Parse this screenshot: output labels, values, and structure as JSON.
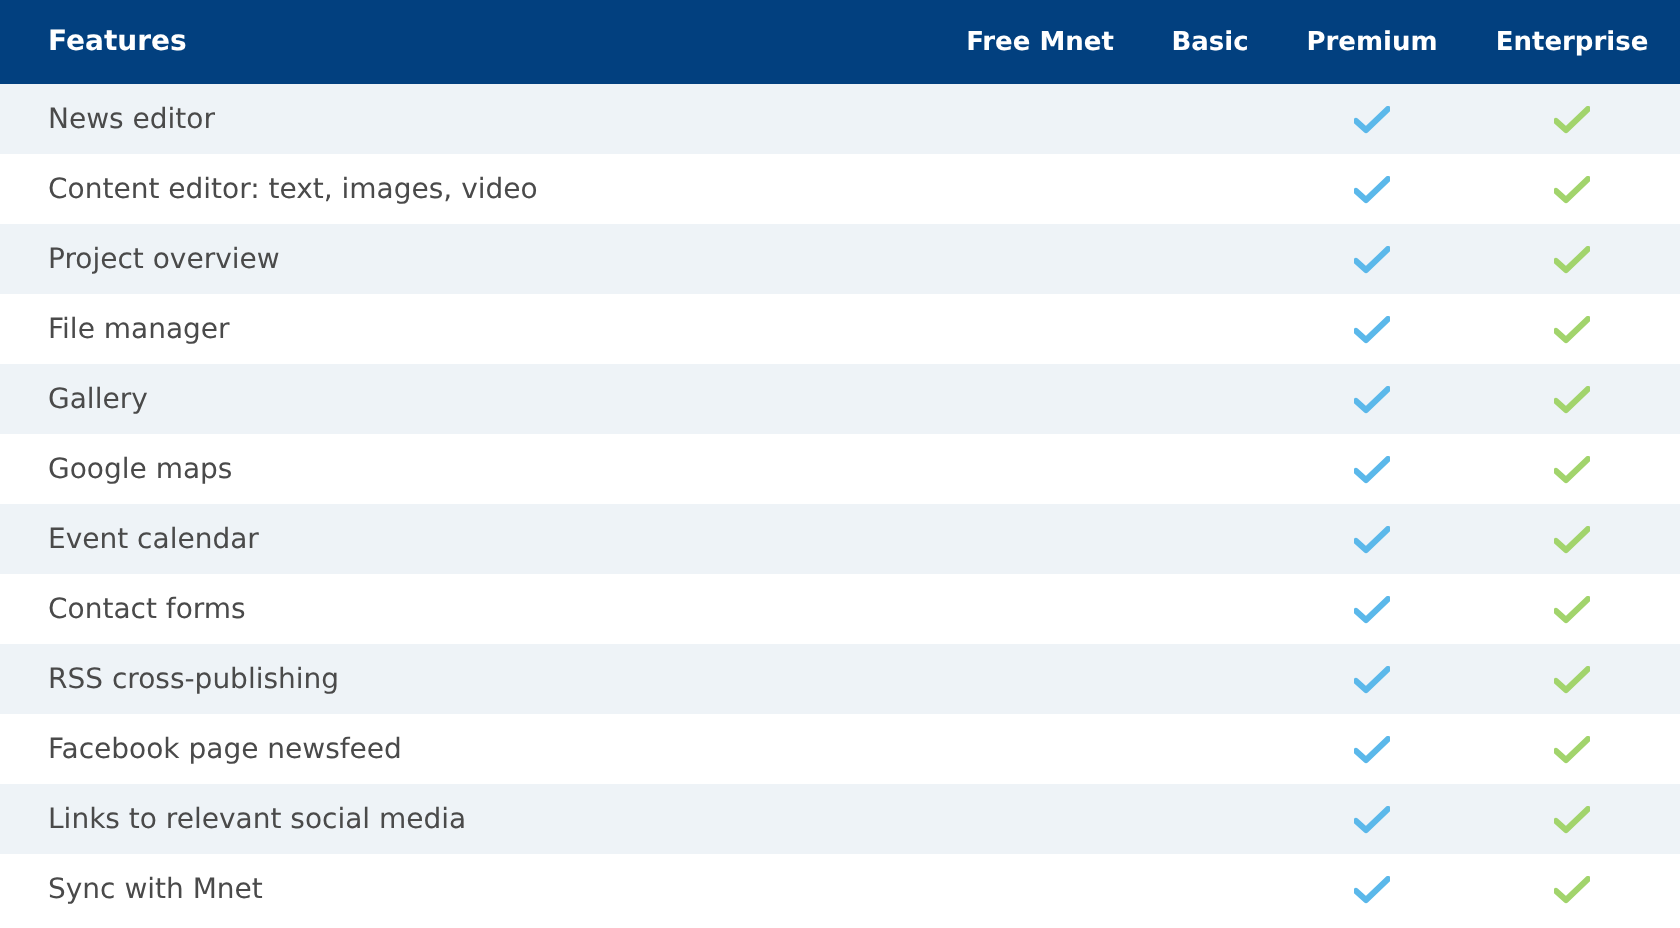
{
  "table": {
    "columns": [
      {
        "label": "Features"
      },
      {
        "label": "Free Mnet"
      },
      {
        "label": "Basic"
      },
      {
        "label": "Premium"
      },
      {
        "label": "Enterprise"
      }
    ],
    "rows": [
      {
        "feature": "News editor",
        "cells": [
          {
            "checked": false
          },
          {
            "checked": false
          },
          {
            "checked": true
          },
          {
            "checked": true
          }
        ]
      },
      {
        "feature": "Content editor: text, images, video",
        "cells": [
          {
            "checked": false
          },
          {
            "checked": false
          },
          {
            "checked": true
          },
          {
            "checked": true
          }
        ]
      },
      {
        "feature": "Project overview",
        "cells": [
          {
            "checked": false
          },
          {
            "checked": false
          },
          {
            "checked": true
          },
          {
            "checked": true
          }
        ]
      },
      {
        "feature": "File manager",
        "cells": [
          {
            "checked": false
          },
          {
            "checked": false
          },
          {
            "checked": true
          },
          {
            "checked": true
          }
        ]
      },
      {
        "feature": "Gallery",
        "cells": [
          {
            "checked": false
          },
          {
            "checked": false
          },
          {
            "checked": true
          },
          {
            "checked": true
          }
        ]
      },
      {
        "feature": "Google maps",
        "cells": [
          {
            "checked": false
          },
          {
            "checked": false
          },
          {
            "checked": true
          },
          {
            "checked": true
          }
        ]
      },
      {
        "feature": "Event calendar",
        "cells": [
          {
            "checked": false
          },
          {
            "checked": false
          },
          {
            "checked": true
          },
          {
            "checked": true
          }
        ]
      },
      {
        "feature": "Contact forms",
        "cells": [
          {
            "checked": false
          },
          {
            "checked": false
          },
          {
            "checked": true
          },
          {
            "checked": true
          }
        ]
      },
      {
        "feature": "RSS cross-publishing",
        "cells": [
          {
            "checked": false
          },
          {
            "checked": false
          },
          {
            "checked": true
          },
          {
            "checked": true
          }
        ]
      },
      {
        "feature": "Facebook page newsfeed",
        "cells": [
          {
            "checked": false
          },
          {
            "checked": false
          },
          {
            "checked": true
          },
          {
            "checked": true
          }
        ]
      },
      {
        "feature": "Links to relevant social media",
        "cells": [
          {
            "checked": false
          },
          {
            "checked": false
          },
          {
            "checked": true
          },
          {
            "checked": true
          }
        ]
      },
      {
        "feature": "Sync with Mnet",
        "cells": [
          {
            "checked": false
          },
          {
            "checked": false
          },
          {
            "checked": true
          },
          {
            "checked": true
          }
        ]
      }
    ]
  }
}
